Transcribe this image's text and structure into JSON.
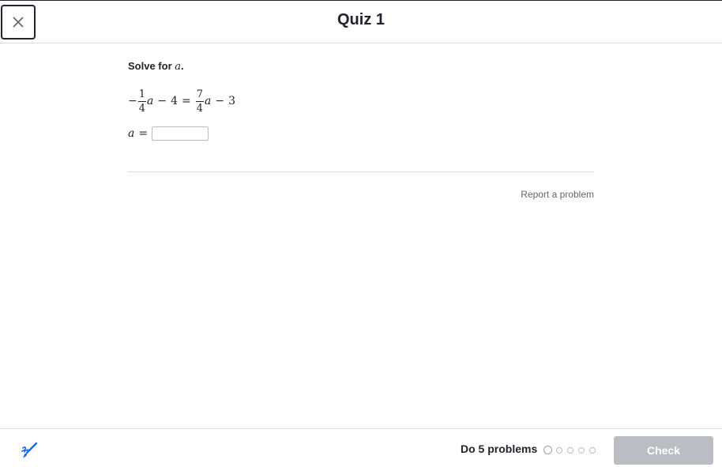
{
  "header": {
    "title": "Quiz 1"
  },
  "question": {
    "prompt_text": "Solve for ",
    "prompt_var": "a",
    "prompt_end": ".",
    "equation": {
      "neg_sign": "−",
      "lhs_frac_num": "1",
      "lhs_frac_den": "4",
      "lhs_var": "a",
      "lhs_op": "−",
      "lhs_const": "4",
      "equals": "=",
      "rhs_frac_num": "7",
      "rhs_frac_den": "4",
      "rhs_var": "a",
      "rhs_op": "−",
      "rhs_const": "3"
    },
    "answer_var": "a",
    "answer_equals": "=",
    "answer_value": ""
  },
  "report_link": "Report a problem",
  "footer": {
    "do_problems_label": "Do 5 problems",
    "problem_count": 5,
    "current_problem": 1,
    "check_label": "Check"
  },
  "colors": {
    "scratchpad_blue": "#1865f2",
    "check_disabled": "#babec2"
  }
}
